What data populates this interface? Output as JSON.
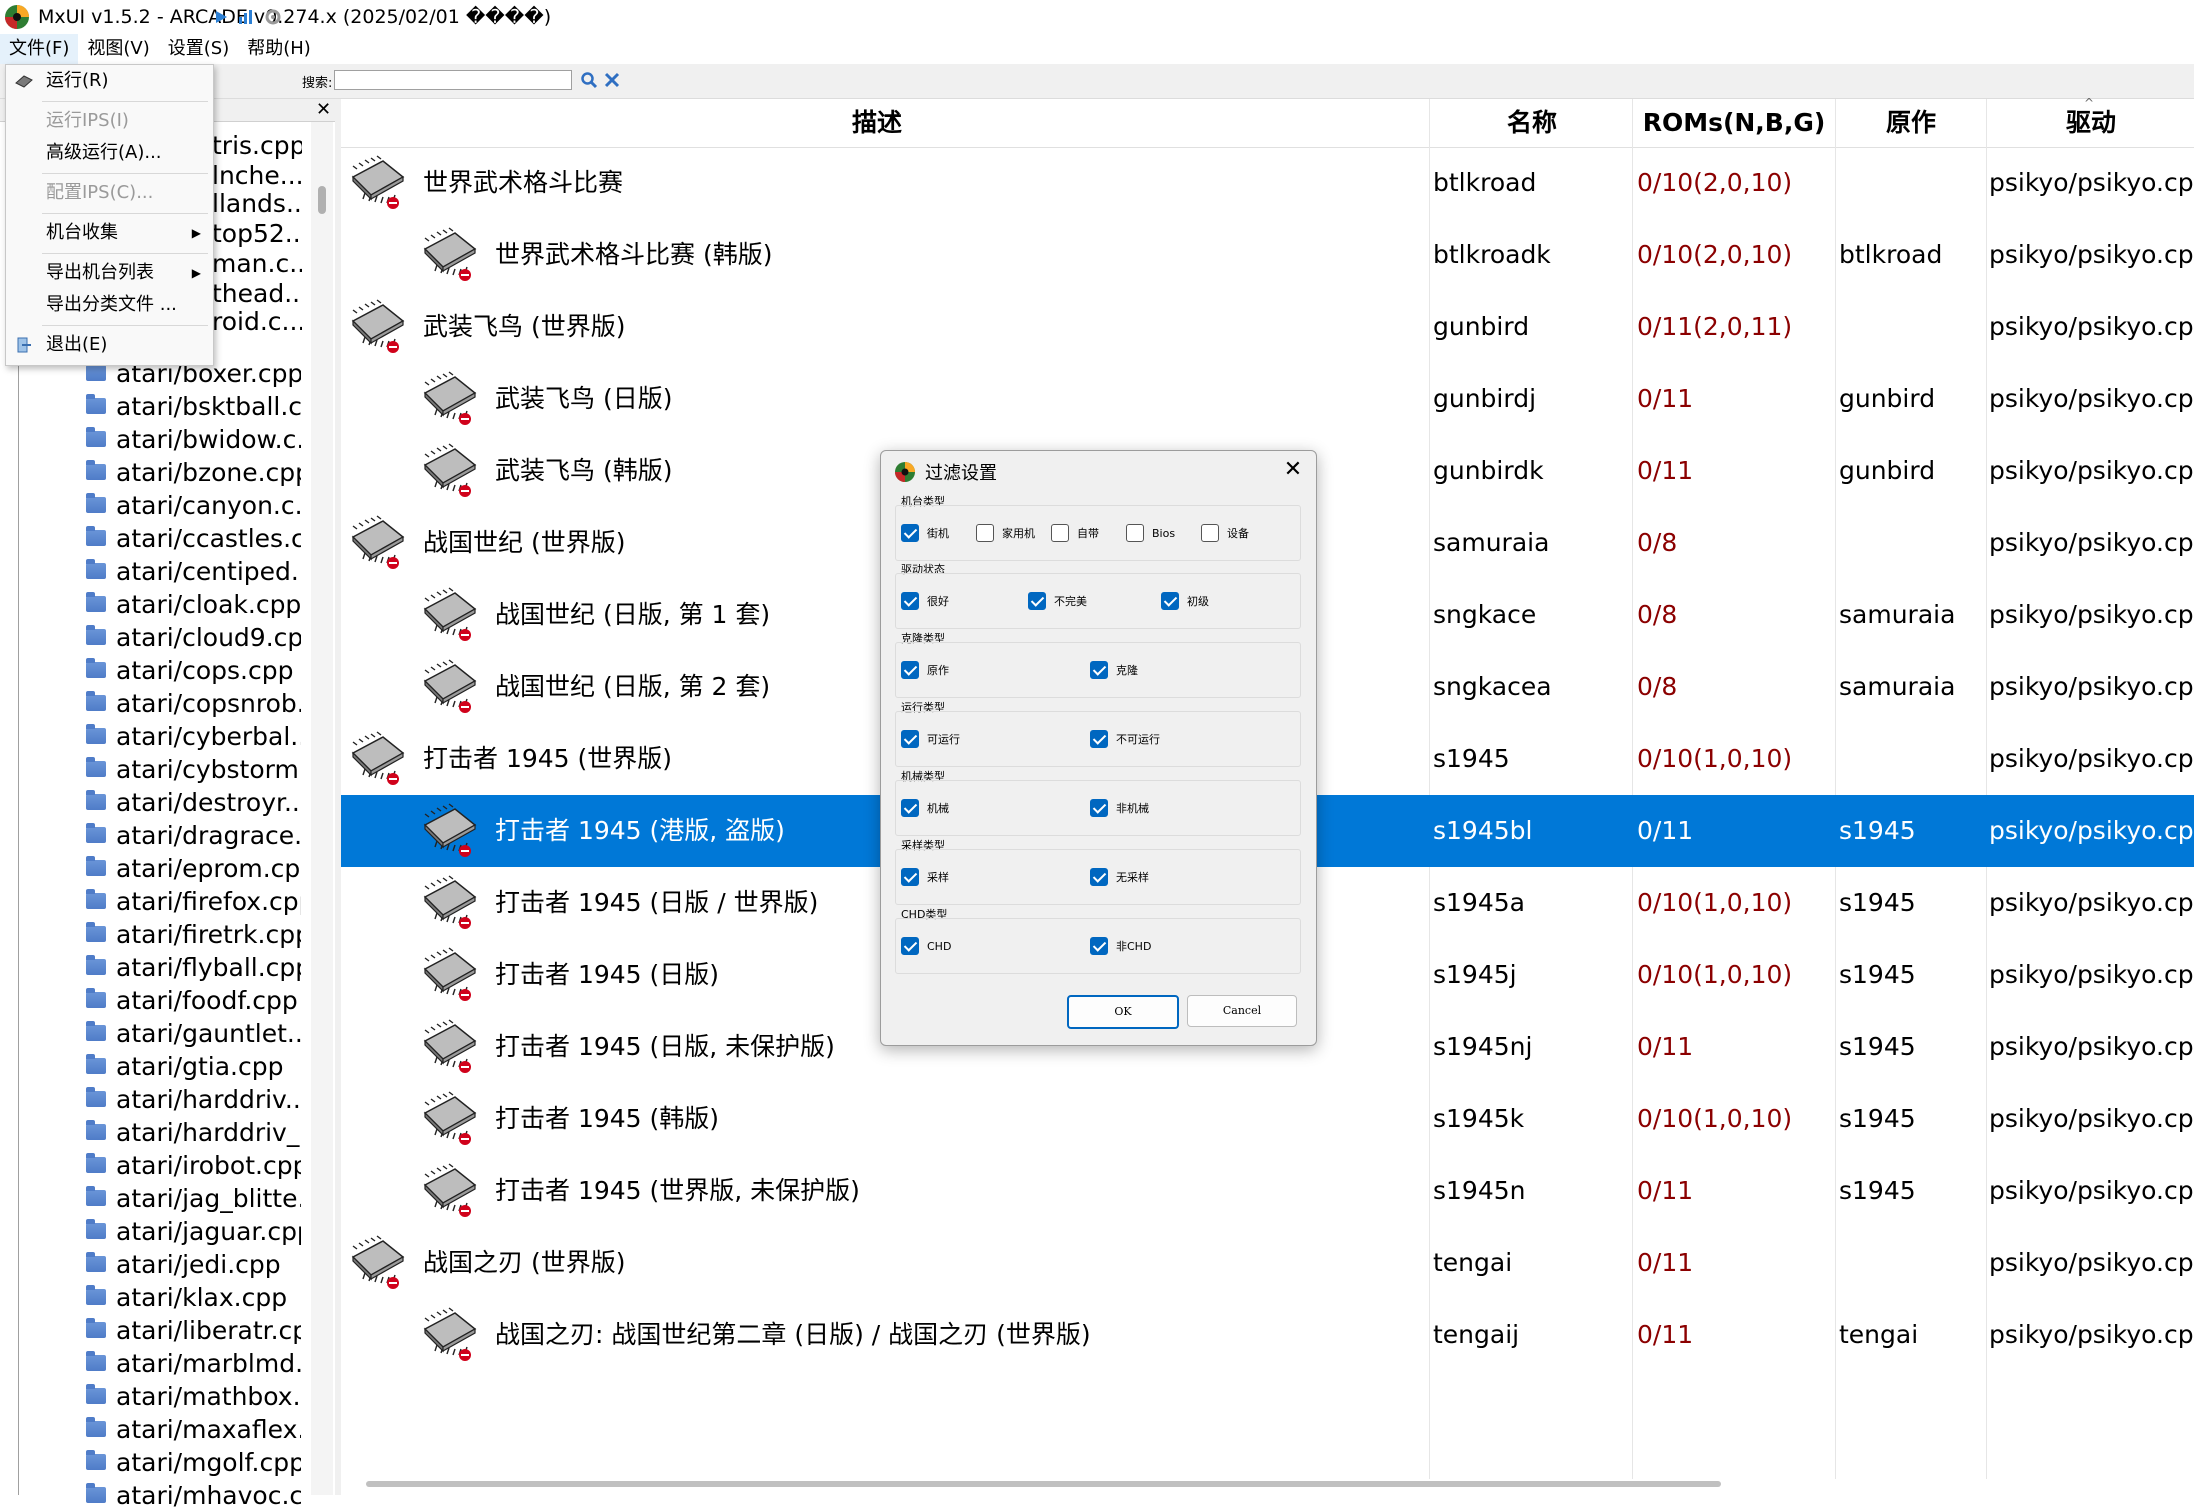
{
  "window": {
    "title": "MxUI v1.5.2 - ARCADE v0.274.x (2025/02/01 ����)"
  },
  "menubar": [
    "文件(F)",
    "视图(V)",
    "设置(S)",
    "帮助(H)"
  ],
  "toolbar": {
    "search_label": "搜索:",
    "search_value": ""
  },
  "file_menu": [
    {
      "label": "运行(R)",
      "enabled": true,
      "icon": "run-icon"
    },
    {
      "label": "运行IPS(I)",
      "enabled": false
    },
    {
      "label": "高级运行(A)...",
      "enabled": true
    },
    {
      "label": "配置IPS(C)...",
      "enabled": false
    },
    {
      "label": "机台收集",
      "enabled": true,
      "submenu": true
    },
    {
      "label": "导出机台列表",
      "enabled": true,
      "submenu": true
    },
    {
      "label": "导出分类文件 ...",
      "enabled": true
    },
    {
      "label": "退出(E)",
      "enabled": true,
      "icon": "exit-icon"
    }
  ],
  "tree_partial": [
    "tris.cpp",
    "lnche....",
    "llands....",
    "top52...",
    "man.c...",
    "thead...",
    "roid.c..."
  ],
  "tree": [
    "atari/boxer.cpp",
    "atari/bsktball.c...",
    "atari/bwidow.c...",
    "atari/bzone.cpp",
    "atari/canyon.c...",
    "atari/ccastles.c...",
    "atari/centiped....",
    "atari/cloak.cpp",
    "atari/cloud9.cpp",
    "atari/cops.cpp",
    "atari/copsnrob...",
    "atari/cyberbal....",
    "atari/cybstorm...",
    "atari/destroyr....",
    "atari/dragrace....",
    "atari/eprom.cpp",
    "atari/firefox.cpp",
    "atari/firetrk.cpp",
    "atari/flyball.cpp",
    "atari/foodf.cpp",
    "atari/gauntlet....",
    "atari/gtia.cpp",
    "atari/harddriv....",
    "atari/harddriv_...",
    "atari/irobot.cpp",
    "atari/jag_blitte...",
    "atari/jaguar.cpp",
    "atari/jedi.cpp",
    "atari/klax.cpp",
    "atari/liberatr.cpp",
    "atari/marblmd...",
    "atari/mathbox....",
    "atari/maxaflex....",
    "atari/mgolf.cpp",
    "atari/mhavoc.c..."
  ],
  "columns": {
    "desc": "描述",
    "name": "名称",
    "roms": "ROMs(N,B,G)",
    "parent": "原作",
    "driver": "驱动"
  },
  "rows": [
    {
      "desc": "世界武术格斗比赛",
      "name": "btlkroad",
      "roms": "0/10(2,0,10)",
      "parent": "",
      "driver": "psikyo/psikyo.cpp",
      "child": false
    },
    {
      "desc": "世界武术格斗比赛 (韩版)",
      "name": "btlkroadk",
      "roms": "0/10(2,0,10)",
      "parent": "btlkroad",
      "driver": "psikyo/psikyo.cpp",
      "child": true
    },
    {
      "desc": "武装飞鸟 (世界版)",
      "name": "gunbird",
      "roms": "0/11(2,0,11)",
      "parent": "",
      "driver": "psikyo/psikyo.cpp",
      "child": false
    },
    {
      "desc": "武装飞鸟 (日版)",
      "name": "gunbirdj",
      "roms": "0/11",
      "parent": "gunbird",
      "driver": "psikyo/psikyo.cpp",
      "child": true
    },
    {
      "desc": "武装飞鸟 (韩版)",
      "name": "gunbirdk",
      "roms": "0/11",
      "parent": "gunbird",
      "driver": "psikyo/psikyo.cpp",
      "child": true
    },
    {
      "desc": "战国世纪 (世界版)",
      "name": "samuraia",
      "roms": "0/8",
      "parent": "",
      "driver": "psikyo/psikyo.cpp",
      "child": false
    },
    {
      "desc": "战国世纪 (日版, 第 1 套)",
      "name": "sngkace",
      "roms": "0/8",
      "parent": "samuraia",
      "driver": "psikyo/psikyo.cpp",
      "child": true
    },
    {
      "desc": "战国世纪 (日版, 第 2 套)",
      "name": "sngkacea",
      "roms": "0/8",
      "parent": "samuraia",
      "driver": "psikyo/psikyo.cpp",
      "child": true
    },
    {
      "desc": "打击者 1945 (世界版)",
      "name": "s1945",
      "roms": "0/10(1,0,10)",
      "parent": "",
      "driver": "psikyo/psikyo.cpp",
      "child": false
    },
    {
      "desc": "打击者 1945 (港版, 盗版)",
      "name": "s1945bl",
      "roms": "0/11",
      "parent": "s1945",
      "driver": "psikyo/psikyo.cpp",
      "child": true,
      "selected": true
    },
    {
      "desc": "打击者 1945 (日版 / 世界版)",
      "name": "s1945a",
      "roms": "0/10(1,0,10)",
      "parent": "s1945",
      "driver": "psikyo/psikyo.cpp",
      "child": true
    },
    {
      "desc": "打击者 1945 (日版)",
      "name": "s1945j",
      "roms": "0/10(1,0,10)",
      "parent": "s1945",
      "driver": "psikyo/psikyo.cpp",
      "child": true
    },
    {
      "desc": "打击者 1945 (日版, 未保护版)",
      "name": "s1945nj",
      "roms": "0/11",
      "parent": "s1945",
      "driver": "psikyo/psikyo.cpp",
      "child": true
    },
    {
      "desc": "打击者 1945 (韩版)",
      "name": "s1945k",
      "roms": "0/10(1,0,10)",
      "parent": "s1945",
      "driver": "psikyo/psikyo.cpp",
      "child": true
    },
    {
      "desc": "打击者 1945 (世界版, 未保护版)",
      "name": "s1945n",
      "roms": "0/11",
      "parent": "s1945",
      "driver": "psikyo/psikyo.cpp",
      "child": true
    },
    {
      "desc": "战国之刃 (世界版)",
      "name": "tengai",
      "roms": "0/11",
      "parent": "",
      "driver": "psikyo/psikyo.cpp",
      "child": false
    },
    {
      "desc": "战国之刃: 战国世纪第二章 (日版) / 战国之刃 (世界版)",
      "name": "tengaij",
      "roms": "0/11",
      "parent": "tengai",
      "driver": "psikyo/psikyo.cpp",
      "child": true
    }
  ],
  "dialog": {
    "title": "过滤设置",
    "groups": [
      {
        "title": "机台类型",
        "options": [
          {
            "label": "街机",
            "checked": true
          },
          {
            "label": "家用机",
            "checked": false
          },
          {
            "label": "自带",
            "checked": false
          },
          {
            "label": "Bios",
            "checked": false
          },
          {
            "label": "设备",
            "checked": false
          }
        ]
      },
      {
        "title": "驱动状态",
        "options": [
          {
            "label": "很好",
            "checked": true
          },
          {
            "label": "不完美",
            "checked": true
          },
          {
            "label": "初级",
            "checked": true
          }
        ]
      },
      {
        "title": "克隆类型",
        "options": [
          {
            "label": "原作",
            "checked": true
          },
          {
            "label": "克隆",
            "checked": true
          }
        ]
      },
      {
        "title": "运行类型",
        "options": [
          {
            "label": "可运行",
            "checked": true
          },
          {
            "label": "不可运行",
            "checked": true
          }
        ]
      },
      {
        "title": "机械类型",
        "options": [
          {
            "label": "机械",
            "checked": true
          },
          {
            "label": "非机械",
            "checked": true
          }
        ]
      },
      {
        "title": "采样类型",
        "options": [
          {
            "label": "采样",
            "checked": true
          },
          {
            "label": "无采样",
            "checked": true
          }
        ]
      },
      {
        "title": "CHD类型",
        "options": [
          {
            "label": "CHD",
            "checked": true
          },
          {
            "label": "非CHD",
            "checked": true
          }
        ]
      }
    ],
    "ok": "OK",
    "cancel": "Cancel"
  },
  "colors": {
    "selection": "#0078d7",
    "rom_missing": "#8b0000",
    "checkbox": "#0067c0"
  }
}
